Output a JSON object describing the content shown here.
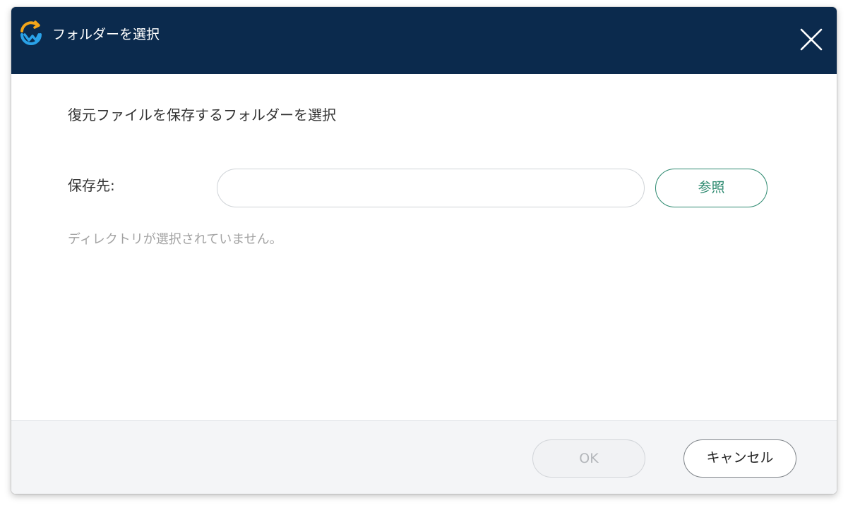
{
  "window": {
    "title": "フォルダーを選択"
  },
  "content": {
    "instruction": "復元ファイルを保存するフォルダーを選択",
    "destination_label": "保存先:",
    "path_value": "",
    "browse_label": "参照",
    "status_message": "ディレクトリが選択されていません。"
  },
  "footer": {
    "ok_label": "OK",
    "cancel_label": "キャンセル"
  },
  "icons": {
    "app_logo": "app-logo-icon",
    "close": "close-icon"
  },
  "colors": {
    "titlebar_bg": "#0b2a4d",
    "accent_green": "#2e8a70",
    "logo_orange": "#f2a51a",
    "logo_blue": "#2aa2e8"
  }
}
